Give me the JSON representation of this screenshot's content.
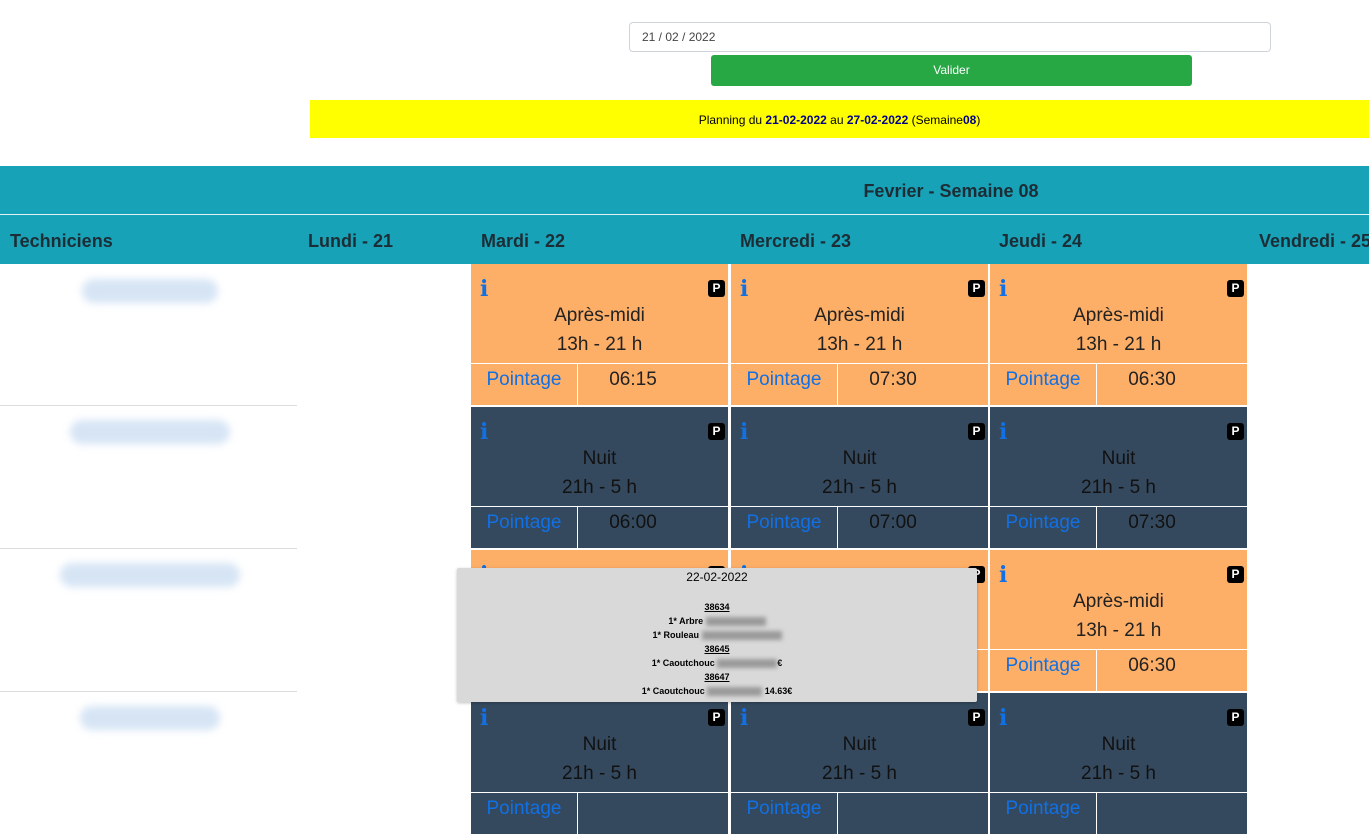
{
  "form": {
    "date_value": "21 / 02 / 2022",
    "submit_label": "Valider"
  },
  "planning": {
    "prefix": "Planning du",
    "start": "21-02-2022",
    "middle": "au",
    "end": "27-02-2022",
    "week_open": "(Semaine",
    "week": "08",
    "week_close": ")"
  },
  "header": {
    "month_title": "Fevrier - Semaine 08",
    "techs_label": "Techniciens",
    "days": [
      "Lundi - 21",
      "Mardi - 22",
      "Mercredi - 23",
      "Jeudi - 24",
      "Vendredi - 25"
    ]
  },
  "shift_labels": {
    "pointage": "Pointage",
    "info_icon": "info-icon",
    "parking_icon": "parking-icon",
    "parking_glyph": "P",
    "info_glyph": "i"
  },
  "rows": [
    {
      "cells": [
        {
          "type": "Après-midi",
          "hours": "13h - 21 h",
          "time": "06:15",
          "color": "#fdae67"
        },
        {
          "type": "Après-midi",
          "hours": "13h - 21 h",
          "time": "07:30",
          "color": "#fdae67"
        },
        {
          "type": "Après-midi",
          "hours": "13h - 21 h",
          "time": "06:30",
          "color": "#fdae67"
        }
      ]
    },
    {
      "cells": [
        {
          "type": "Nuit",
          "hours": "21h - 5 h",
          "time": "06:00",
          "color": "#34495e"
        },
        {
          "type": "Nuit",
          "hours": "21h - 5 h",
          "time": "07:00",
          "color": "#34495e"
        },
        {
          "type": "Nuit",
          "hours": "21h - 5 h",
          "time": "07:30",
          "color": "#34495e"
        }
      ]
    },
    {
      "cells": [
        {
          "type": "",
          "hours": "",
          "time": "",
          "color": "#fdae67"
        },
        {
          "type": "",
          "hours": "",
          "time": "",
          "color": "#fdae67"
        },
        {
          "type": "Après-midi",
          "hours": "13h - 21 h",
          "time": "06:30",
          "color": "#fdae67"
        }
      ]
    },
    {
      "cells": [
        {
          "type": "Nuit",
          "hours": "21h - 5 h",
          "time": "",
          "color": "#34495e"
        },
        {
          "type": "Nuit",
          "hours": "21h - 5 h",
          "time": "",
          "color": "#34495e"
        },
        {
          "type": "Nuit",
          "hours": "21h - 5 h",
          "time": "",
          "color": "#34495e"
        }
      ]
    }
  ],
  "tooltip": {
    "date": "22-02-2022",
    "orders": [
      {
        "number": "38634",
        "items": [
          {
            "qty": "1*",
            "name": "Arbre",
            "price": ""
          },
          {
            "qty": "1*",
            "name": "Rouleau",
            "price": ""
          }
        ]
      },
      {
        "number": "38645",
        "items": [
          {
            "qty": "1*",
            "name": "Caoutchouc",
            "price": "€"
          }
        ]
      },
      {
        "number": "38647",
        "items": [
          {
            "qty": "1*",
            "name": "Caoutchouc",
            "price": "14.63€"
          }
        ]
      }
    ]
  }
}
